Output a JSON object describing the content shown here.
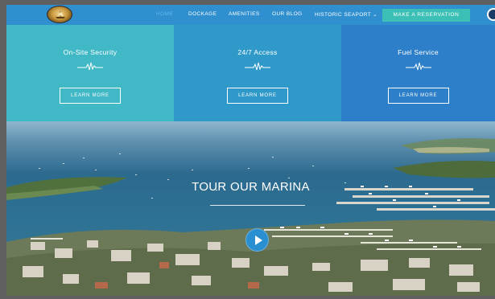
{
  "header": {
    "logo": "marina-seal-logo",
    "nav": [
      {
        "label": "HOME",
        "active": true
      },
      {
        "label": "DOCKAGE",
        "active": false
      },
      {
        "label": "AMENITIES",
        "active": false
      },
      {
        "label": "OUR BLOG",
        "active": false
      },
      {
        "label": "HISTORIC SEAPORT ⌄",
        "active": false
      }
    ],
    "reserve_label": "MAKE A RESERVATION",
    "accent": "#3cc0b6",
    "bar_color": "#2f8fcf"
  },
  "features": [
    {
      "title": "On-Site Security",
      "button": "LEARN MORE",
      "color": "#41b8c6",
      "icon": "pulse-icon"
    },
    {
      "title": "24/7 Access",
      "button": "LEARN MORE",
      "color": "#2f9ac9",
      "icon": "pulse-icon"
    },
    {
      "title": "Fuel Service",
      "button": "LEARN MORE",
      "color": "#2c7fc8",
      "icon": "pulse-icon"
    }
  ],
  "hero": {
    "title": "TOUR OUR MARINA",
    "play_icon": "play-icon"
  }
}
